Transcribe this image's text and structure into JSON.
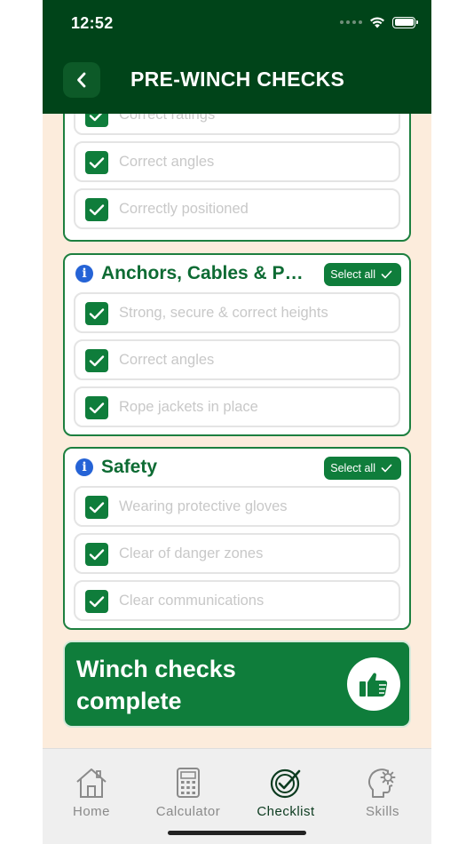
{
  "status": {
    "time": "12:52"
  },
  "header": {
    "title": "PRE-WINCH CHECKS"
  },
  "sections": [
    {
      "title": "",
      "items": [
        "Correct ratings",
        "Correct angles",
        "Correctly positioned"
      ]
    },
    {
      "title": "Anchors, Cables & Pulleys",
      "select_all": "Select all",
      "items": [
        "Strong, secure & correct heights",
        "Correct angles",
        "Rope jackets in place"
      ]
    },
    {
      "title": "Safety",
      "select_all": "Select all",
      "items": [
        "Wearing protective gloves",
        "Clear of danger zones",
        "Clear communications"
      ]
    }
  ],
  "complete": {
    "label": "Winch checks complete"
  },
  "tabs": [
    {
      "label": "Home",
      "icon": "home-icon"
    },
    {
      "label": "Calculator",
      "icon": "calculator-icon"
    },
    {
      "label": "Checklist",
      "icon": "checklist-icon",
      "active": true
    },
    {
      "label": "Skills",
      "icon": "skills-icon"
    }
  ],
  "colors": {
    "header": "#004419",
    "accent": "#0f7d3b",
    "background": "#fcecdc",
    "info": "#2563d6"
  }
}
